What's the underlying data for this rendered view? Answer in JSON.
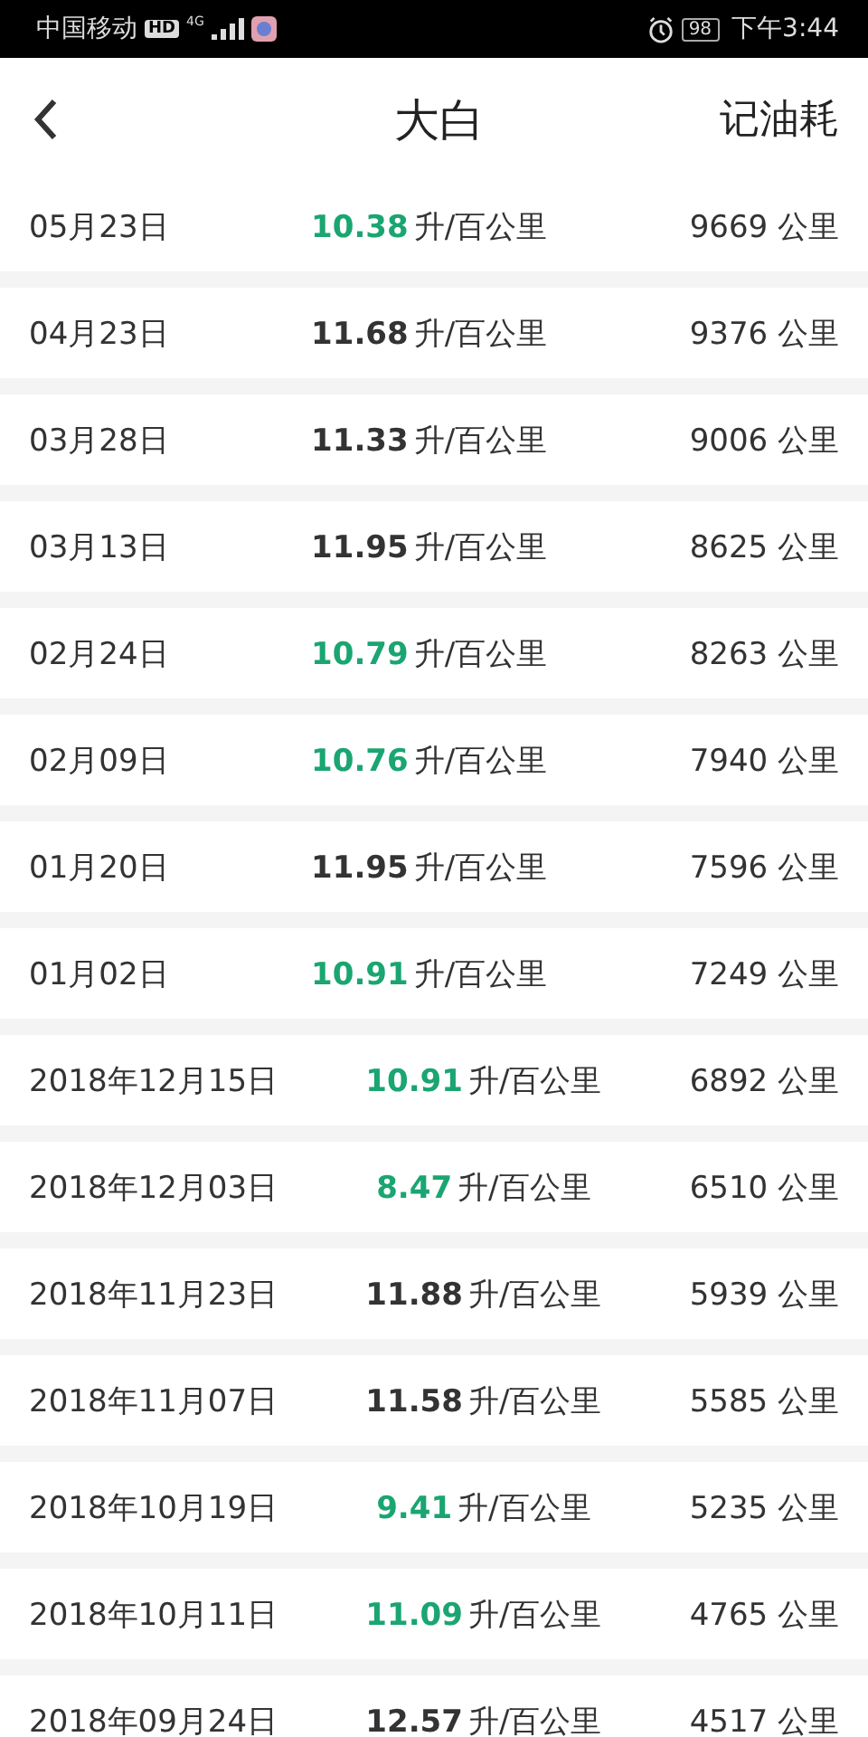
{
  "status_bar": {
    "carrier": "中国移动",
    "hd": "HD",
    "network": "4G",
    "battery": "98",
    "time": "下午3:44"
  },
  "header": {
    "title": "大白",
    "action": "记油耗"
  },
  "records": [
    {
      "date": "05月23日",
      "value": "10.38",
      "unit": "升/百公里",
      "odometer": "9669 公里",
      "highlighted": true
    },
    {
      "date": "04月23日",
      "value": "11.68",
      "unit": "升/百公里",
      "odometer": "9376 公里",
      "highlighted": false
    },
    {
      "date": "03月28日",
      "value": "11.33",
      "unit": "升/百公里",
      "odometer": "9006 公里",
      "highlighted": false
    },
    {
      "date": "03月13日",
      "value": "11.95",
      "unit": "升/百公里",
      "odometer": "8625 公里",
      "highlighted": false
    },
    {
      "date": "02月24日",
      "value": "10.79",
      "unit": "升/百公里",
      "odometer": "8263 公里",
      "highlighted": true
    },
    {
      "date": "02月09日",
      "value": "10.76",
      "unit": "升/百公里",
      "odometer": "7940 公里",
      "highlighted": true
    },
    {
      "date": "01月20日",
      "value": "11.95",
      "unit": "升/百公里",
      "odometer": "7596 公里",
      "highlighted": false
    },
    {
      "date": "01月02日",
      "value": "10.91",
      "unit": "升/百公里",
      "odometer": "7249 公里",
      "highlighted": true
    },
    {
      "date": "2018年12月15日",
      "value": "10.91",
      "unit": "升/百公里",
      "odometer": "6892 公里",
      "highlighted": true
    },
    {
      "date": "2018年12月03日",
      "value": "8.47",
      "unit": "升/百公里",
      "odometer": "6510 公里",
      "highlighted": true
    },
    {
      "date": "2018年11月23日",
      "value": "11.88",
      "unit": "升/百公里",
      "odometer": "5939 公里",
      "highlighted": false
    },
    {
      "date": "2018年11月07日",
      "value": "11.58",
      "unit": "升/百公里",
      "odometer": "5585 公里",
      "highlighted": false
    },
    {
      "date": "2018年10月19日",
      "value": "9.41",
      "unit": "升/百公里",
      "odometer": "5235 公里",
      "highlighted": true
    },
    {
      "date": "2018年10月11日",
      "value": "11.09",
      "unit": "升/百公里",
      "odometer": "4765 公里",
      "highlighted": true
    },
    {
      "date": "2018年09月24日",
      "value": "12.57",
      "unit": "升/百公里",
      "odometer": "4517 公里",
      "highlighted": false
    }
  ]
}
